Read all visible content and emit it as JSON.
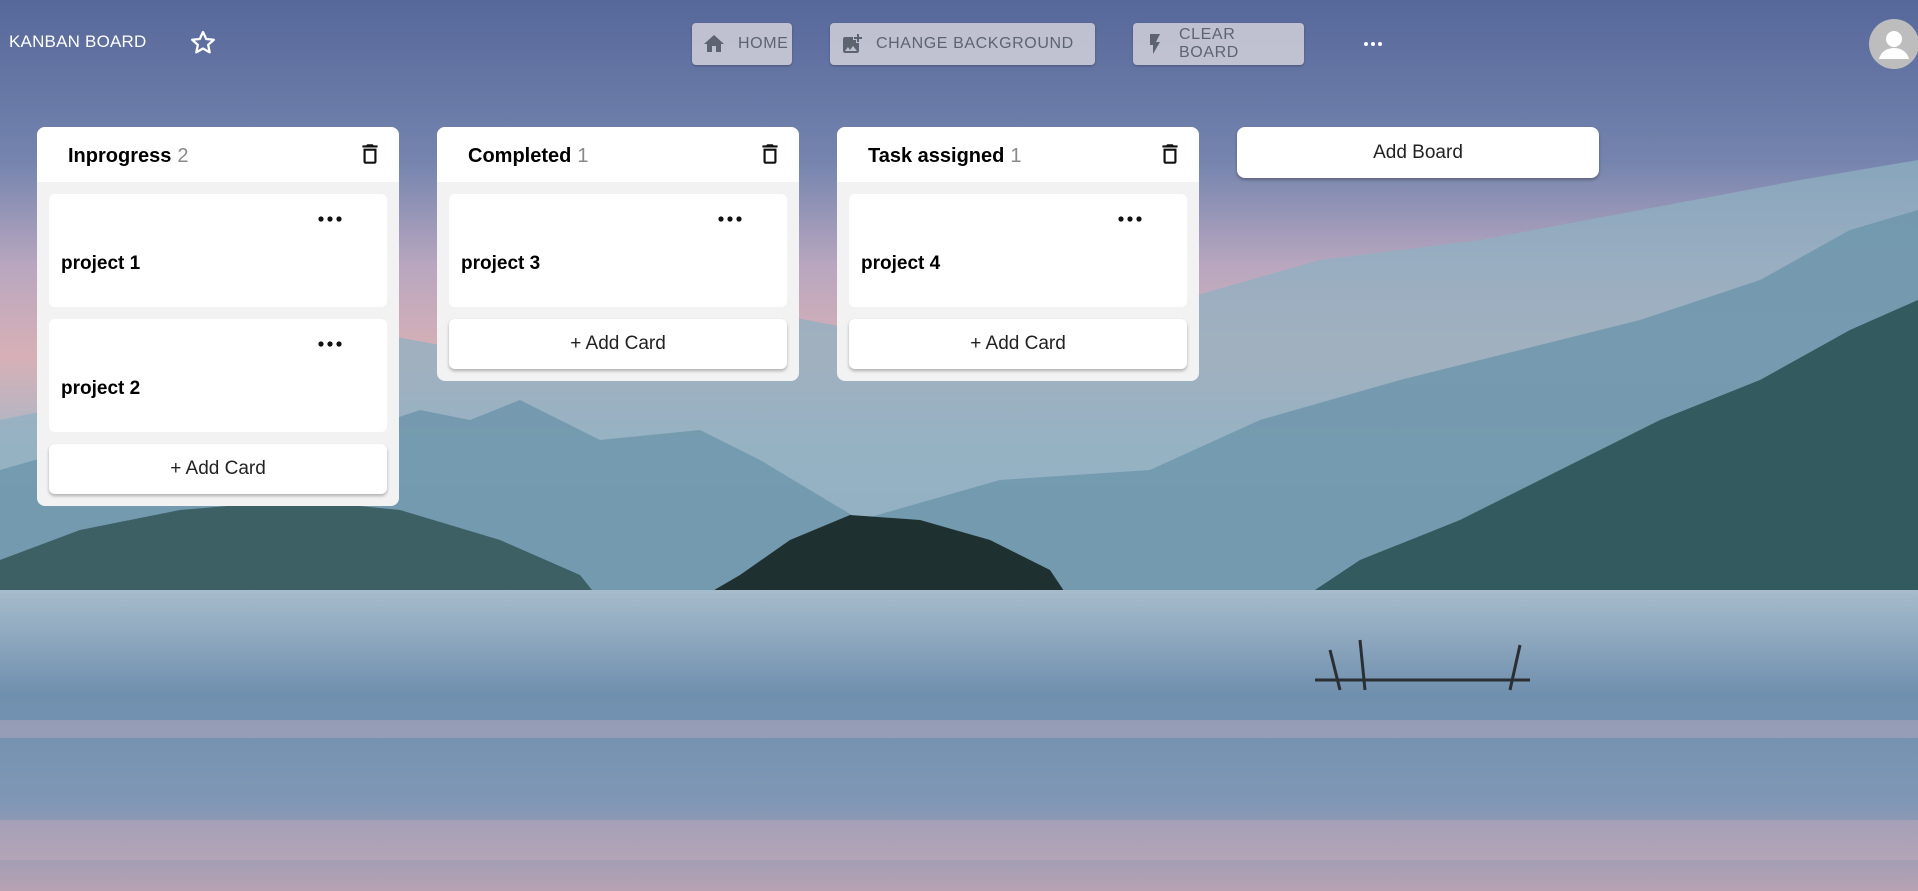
{
  "header": {
    "title": "KANBAN BOARD",
    "buttons": [
      {
        "label": "HOME",
        "icon": "home-icon"
      },
      {
        "label": "CHANGE BACKGROUND",
        "icon": "add-photo-icon"
      },
      {
        "label": "CLEAR BOARD",
        "icon": "flash-icon"
      }
    ]
  },
  "boards": [
    {
      "title": "Inprogress",
      "count": "2",
      "cards": [
        "project 1",
        "project 2"
      ],
      "add_card_label": "+ Add Card"
    },
    {
      "title": "Completed",
      "count": "1",
      "cards": [
        "project 3"
      ],
      "add_card_label": "+ Add Card"
    },
    {
      "title": "Task assigned",
      "count": "1",
      "cards": [
        "project 4"
      ],
      "add_card_label": "+ Add Card"
    }
  ],
  "add_board_label": "Add Board",
  "colors": {
    "sky_top": "#5f6f9c",
    "sky_pink": "#d7aab0",
    "mountain": "#5f8ba2",
    "water": "#7b9ab6",
    "header_button_bg": "#cdcdd7",
    "board_bg": "#f2f2f2"
  }
}
